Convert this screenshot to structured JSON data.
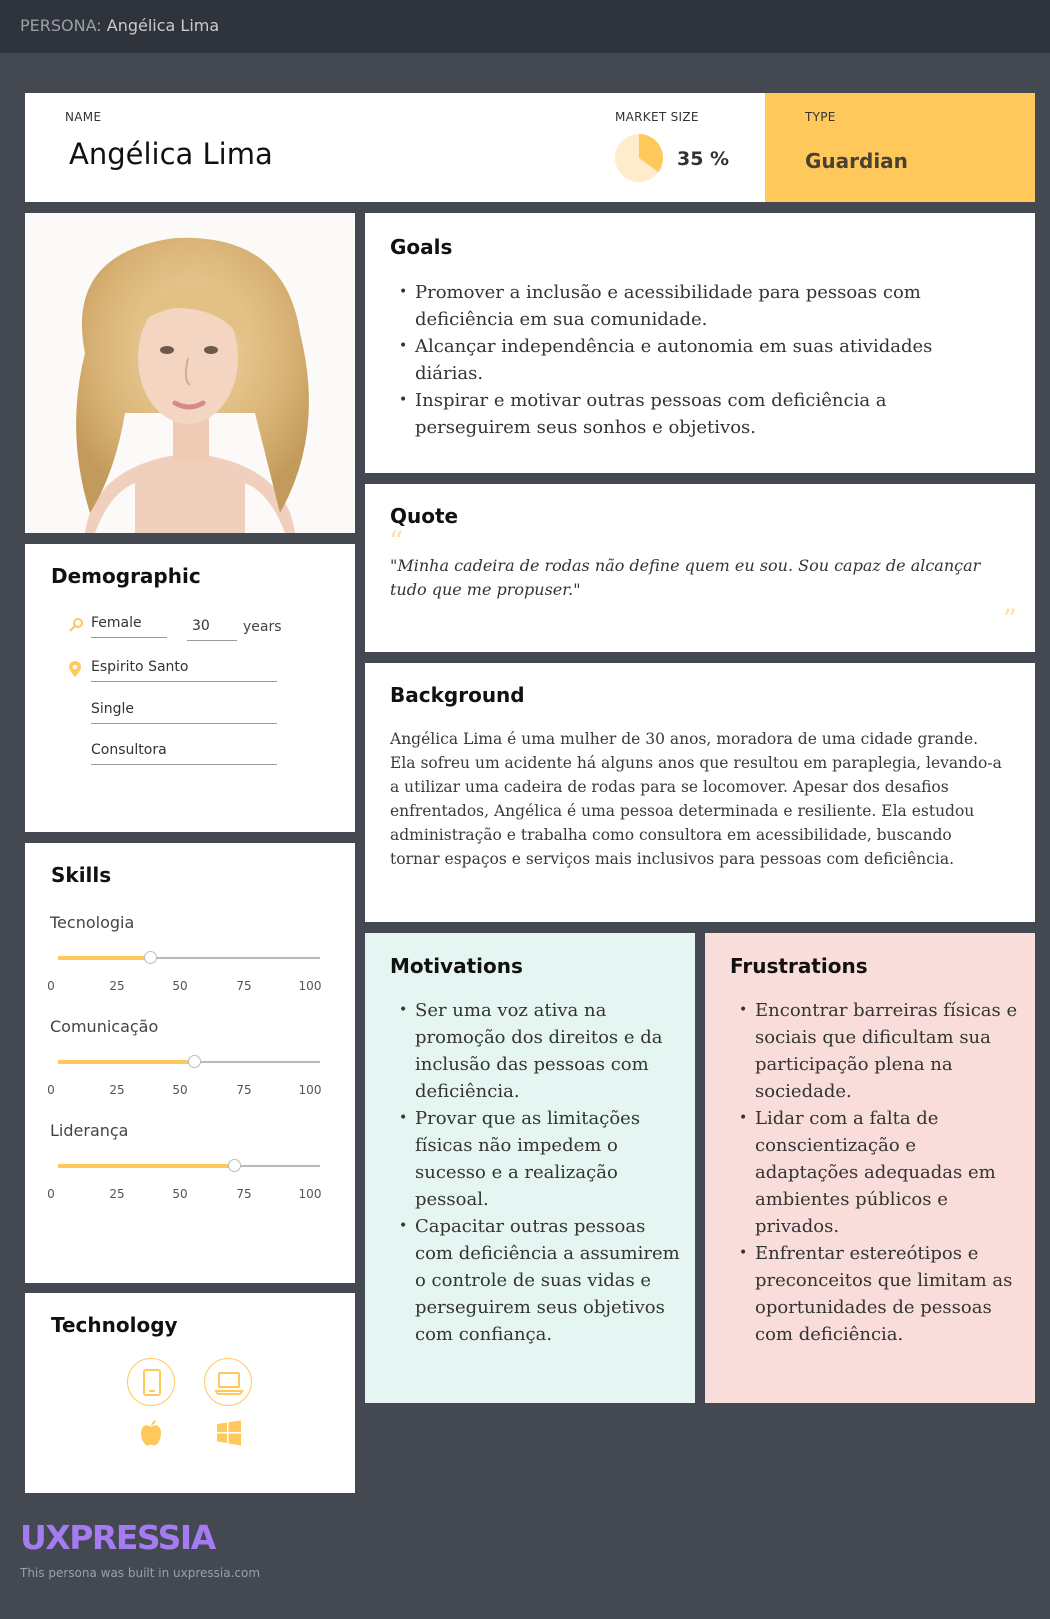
{
  "topbar": {
    "label": "PERSONA:",
    "name": "Angélica Lima"
  },
  "header": {
    "name_label": "NAME",
    "name": "Angélica Lima",
    "market_label": "MARKET SIZE",
    "market_value": "35 %",
    "market_fraction": 0.35,
    "type_label": "TYPE",
    "type_value": "Guardian"
  },
  "photo": {
    "description": "portrait of a young woman with curly blonde hair"
  },
  "goals": {
    "title": "Goals",
    "items": [
      "Promover a inclusão e acessibilidade para pessoas com deficiência em sua comunidade.",
      "Alcançar independência e autonomia em suas atividades diárias.",
      "Inspirar e motivar outras pessoas com deficiência a perseguirem seus sonhos e objetivos."
    ]
  },
  "quote": {
    "title": "Quote",
    "text": "\"Minha cadeira de rodas não define quem eu sou. Sou capaz de alcançar tudo que me propuser.\""
  },
  "background": {
    "title": "Background",
    "text": "Angélica Lima é uma mulher de 30 anos, moradora de uma cidade grande. Ela sofreu um acidente há alguns anos que resultou em paraplegia, levando-a a utilizar uma cadeira de rodas para se locomover. Apesar dos desafios enfrentados, Angélica é uma pessoa determinada e resiliente. Ela estudou administração e trabalha como consultora em acessibilidade, buscando tornar espaços e serviços mais inclusivos para pessoas com deficiência."
  },
  "demographic": {
    "title": "Demographic",
    "gender": "Female",
    "age": "30",
    "age_unit": "years",
    "location": "Espirito Santo",
    "status": "Single",
    "occupation": "Consultora"
  },
  "skills": {
    "title": "Skills",
    "ticks": [
      "0",
      "25",
      "50",
      "75",
      "100"
    ],
    "items": [
      {
        "label": "Tecnologia",
        "value": 35
      },
      {
        "label": "Comunicação",
        "value": 52
      },
      {
        "label": "Liderança",
        "value": 67
      }
    ]
  },
  "technology": {
    "title": "Technology",
    "icons": [
      "tablet-icon",
      "laptop-icon",
      "apple-icon",
      "windows-icon"
    ]
  },
  "motivations": {
    "title": "Motivations",
    "items": [
      "Ser uma voz ativa na promoção dos direitos e da inclusão das pessoas com deficiência.",
      "Provar que as limitações físicas não impedem o sucesso e a realização pessoal.",
      "Capacitar outras pessoas com deficiência a assumirem o controle de suas vidas e perseguirem seus objetivos com confiança."
    ]
  },
  "frustrations": {
    "title": "Frustrations",
    "items": [
      "Encontrar barreiras físicas e sociais que dificultam sua participação plena na sociedade.",
      "Lidar com a falta de conscientização e adaptações adequadas em ambientes públicos e privados.",
      "Enfrentar estereótipos e preconceitos que limitam as oportunidades de pessoas com deficiência."
    ]
  },
  "footer": {
    "logo": "UXPRESSIA",
    "credit": "This persona was built in uxpressia.com"
  },
  "colors": {
    "accent": "#ffc85a",
    "motivations_bg": "#e5f6f2",
    "frustrations_bg": "#f9ddda",
    "page_bg": "#434851"
  }
}
